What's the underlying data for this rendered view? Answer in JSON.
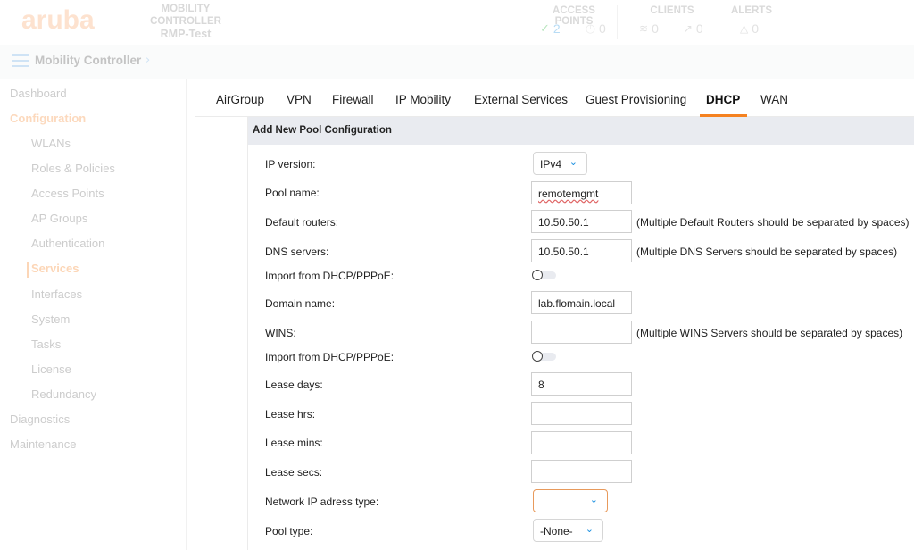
{
  "header": {
    "logo": "aruba",
    "controller_label": "MOBILITY CONTROLLER",
    "controller_name": "RMP-Test",
    "stats": {
      "access_points": {
        "label": "ACCESS POINTS",
        "up": "2",
        "down": "0"
      },
      "clients": {
        "label": "CLIENTS",
        "wireless": "0",
        "wired": "0"
      },
      "alerts": {
        "label": "ALERTS",
        "count": "0"
      }
    }
  },
  "navbar": {
    "title": "Mobility Controller"
  },
  "sidebar": {
    "items": [
      {
        "label": "Dashboard"
      },
      {
        "label": "Configuration"
      },
      {
        "label": "WLANs"
      },
      {
        "label": "Roles & Policies"
      },
      {
        "label": "Access Points"
      },
      {
        "label": "AP Groups"
      },
      {
        "label": "Authentication"
      },
      {
        "label": "Services"
      },
      {
        "label": "Interfaces"
      },
      {
        "label": "System"
      },
      {
        "label": "Tasks"
      },
      {
        "label": "License"
      },
      {
        "label": "Redundancy"
      },
      {
        "label": "Diagnostics"
      },
      {
        "label": "Maintenance"
      }
    ]
  },
  "tabs": [
    {
      "label": "AirGroup"
    },
    {
      "label": "VPN"
    },
    {
      "label": "Firewall"
    },
    {
      "label": "IP Mobility"
    },
    {
      "label": "External Services"
    },
    {
      "label": "Guest Provisioning"
    },
    {
      "label": "DHCP",
      "active": true
    },
    {
      "label": "WAN"
    }
  ],
  "form": {
    "title": "Add New Pool Configuration",
    "ip_version": {
      "label": "IP version:",
      "value": "IPv4"
    },
    "pool_name": {
      "label": "Pool name:",
      "value": "remotemgmt"
    },
    "default_routers": {
      "label": "Default routers:",
      "value": "10.50.50.1",
      "hint": "(Multiple Default Routers should be separated by spaces)"
    },
    "dns_servers": {
      "label": "DNS servers:",
      "value": "10.50.50.1",
      "hint": "(Multiple DNS Servers should be separated by spaces)"
    },
    "import_dns": {
      "label": "Import from DHCP/PPPoE:",
      "on": false
    },
    "domain_name": {
      "label": "Domain name:",
      "value": "lab.flomain.local"
    },
    "wins": {
      "label": "WINS:",
      "value": "",
      "hint": "(Multiple WINS Servers should be separated by spaces)"
    },
    "import_wins": {
      "label": "Import from DHCP/PPPoE:",
      "on": false
    },
    "lease_days": {
      "label": "Lease days:",
      "value": "8"
    },
    "lease_hrs": {
      "label": "Lease hrs:",
      "value": ""
    },
    "lease_mins": {
      "label": "Lease mins:",
      "value": ""
    },
    "lease_secs": {
      "label": "Lease secs:",
      "value": ""
    },
    "network_ip_type": {
      "label": "Network IP adress type:",
      "value": ""
    },
    "pool_type": {
      "label": "Pool type:",
      "value": "-None-"
    }
  },
  "colors": {
    "accent": "#f58220",
    "chevron": "#1a8fe0",
    "panel_header": "#e9ebf0"
  }
}
